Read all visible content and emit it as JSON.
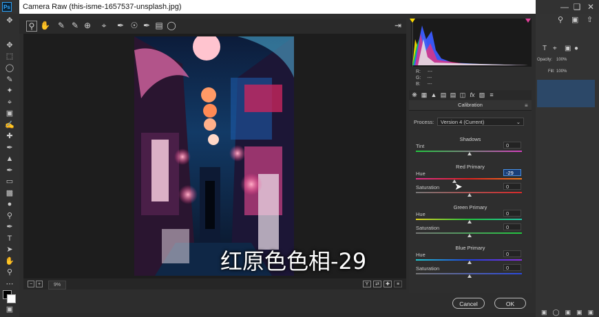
{
  "app": {
    "logo": "Ps"
  },
  "dialog": {
    "title": "Camera Raw (this-isme-1657537-unsplash.jpg)"
  },
  "ps_right": {
    "opacity_label": "Opacity:",
    "opacity_value": "100%",
    "fill_label": "Fill:",
    "fill_value": "100%"
  },
  "preview": {
    "zoom": "9%",
    "overlay_caption": "红原色色相-29"
  },
  "readout": {
    "r": "R:",
    "g": "G:",
    "b": "B:",
    "dash": "---"
  },
  "panel": {
    "title": "Calibration",
    "process_label": "Process:",
    "process_value": "Version 4 (Current)",
    "sections": {
      "shadows": "Shadows",
      "red": "Red Primary",
      "green": "Green Primary",
      "blue": "Blue Primary"
    },
    "labels": {
      "tint": "Tint",
      "hue": "Hue",
      "saturation": "Saturation"
    },
    "values": {
      "tint": "0",
      "red_hue": "-29",
      "red_saturation": "0",
      "green_hue": "0",
      "green_saturation": "0",
      "blue_hue": "0",
      "blue_saturation": "0"
    }
  },
  "buttons": {
    "cancel": "Cancel",
    "ok": "OK"
  },
  "colors": {
    "accent": "#1a3f78",
    "dialog_bg": "#2d2d2d",
    "panel_bg": "#2e2e2e"
  }
}
